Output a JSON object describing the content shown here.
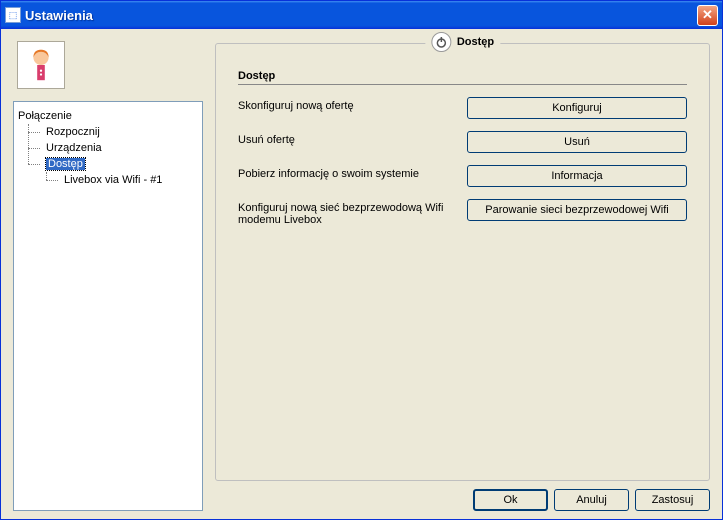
{
  "window": {
    "title": "Ustawienia"
  },
  "tree": {
    "root": "Połączenie",
    "items": {
      "rozpocznij": "Rozpocznij",
      "urzadzenia": "Urządzenia",
      "dostep": "Dostęp",
      "livebox": "Livebox via Wifi - #1"
    }
  },
  "panel": {
    "group_title": "Dostęp",
    "section_header": "Dostęp",
    "rows": {
      "configure_offer": {
        "label": "Skonfiguruj nową ofertę",
        "button": "Konfiguruj"
      },
      "remove_offer": {
        "label": "Usuń ofertę",
        "button": "Usuń"
      },
      "sysinfo": {
        "label": "Pobierz informację o swoim systemie",
        "button": "Informacja"
      },
      "wifi_pair": {
        "label": "Konfiguruj nową sieć bezprzewodową Wifi modemu Livebox",
        "button": "Parowanie sieci bezprzewodowej Wifi"
      }
    }
  },
  "footer": {
    "ok": "Ok",
    "cancel": "Anuluj",
    "apply": "Zastosuj"
  }
}
